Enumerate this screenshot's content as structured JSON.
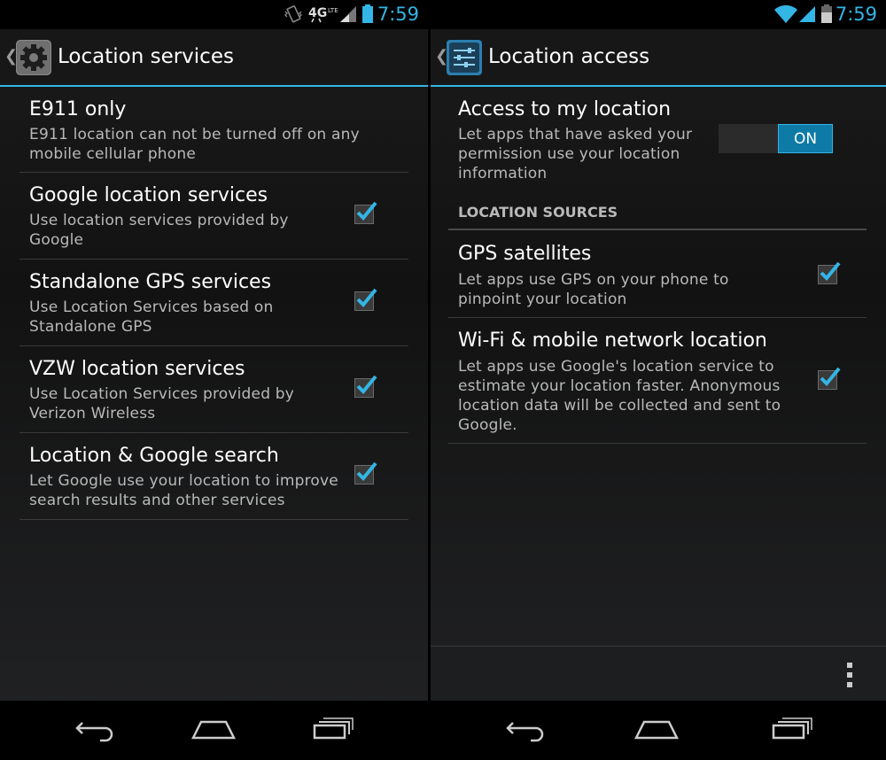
{
  "left": {
    "status": {
      "time": "7:59",
      "network": "4G LTE"
    },
    "title": "Location services",
    "items": [
      {
        "title": "E911 only",
        "summary": "E911 location can not be turned off on any mobile cellular phone",
        "checkbox": false
      },
      {
        "title": "Google location services",
        "summary": "Use location services provided by Google",
        "checkbox": true,
        "checked": true
      },
      {
        "title": "Standalone GPS services",
        "summary": "Use Location Services based on Standalone GPS",
        "checkbox": true,
        "checked": true
      },
      {
        "title": "VZW location services",
        "summary": "Use Location Services provided by Verizon Wireless",
        "checkbox": true,
        "checked": true
      },
      {
        "title": "Location & Google search",
        "summary": "Let Google use your location to improve search results and other services",
        "checkbox": true,
        "checked": true
      }
    ]
  },
  "right": {
    "status": {
      "time": "7:59"
    },
    "title": "Location access",
    "access": {
      "title": "Access to my location",
      "summary": "Let apps that have asked your permission use your location information",
      "toggle": "ON"
    },
    "section_header": "LOCATION SOURCES",
    "items": [
      {
        "title": "GPS satellites",
        "summary": "Let apps use GPS on your phone to pinpoint your location",
        "checked": true
      },
      {
        "title": "Wi-Fi & mobile network location",
        "summary": "Let apps use Google's location service to estimate your location faster. Anonymous location data will be collected and sent to Google.",
        "checked": true
      }
    ]
  },
  "colors": {
    "accent": "#33b5e5",
    "background": "#121212",
    "summary_text": "#b9b9b9"
  },
  "icons": [
    "vibrate-icon",
    "4g-lte-icon",
    "signal-icon",
    "battery-icon",
    "wifi-icon",
    "settings-gear-icon",
    "location-access-icon",
    "back-icon",
    "home-icon",
    "recents-icon",
    "overflow-menu-icon",
    "checkbox-checked-icon"
  ]
}
